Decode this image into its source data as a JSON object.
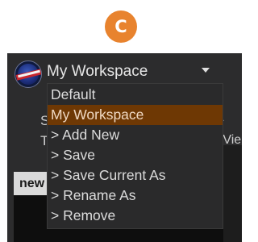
{
  "badge": {
    "letter": "C",
    "color": "#e8832e"
  },
  "header": {
    "logo_icon": "team-logo-icon",
    "workspace_select": {
      "value": "My Workspace",
      "arrow_icon": "caret-down-icon"
    }
  },
  "background": {
    "fragments": [
      {
        "id": "frag-s",
        "text": "S"
      },
      {
        "id": "frag-t",
        "text": "T"
      },
      {
        "id": "frag-vie",
        "text": "e Vie"
      }
    ],
    "chevron_icon": "chevron-right-icon",
    "tab_label": "new"
  },
  "dropdown": {
    "items": [
      {
        "label": "Default",
        "selected": false
      },
      {
        "label": "My Workspace",
        "selected": true
      },
      {
        "label": "> Add New",
        "selected": false
      },
      {
        "label": "> Save",
        "selected": false
      },
      {
        "label": "> Save Current As",
        "selected": false
      },
      {
        "label": "> Rename As",
        "selected": false
      },
      {
        "label": "> Remove",
        "selected": false
      }
    ],
    "selected_color": "#6e3804"
  }
}
